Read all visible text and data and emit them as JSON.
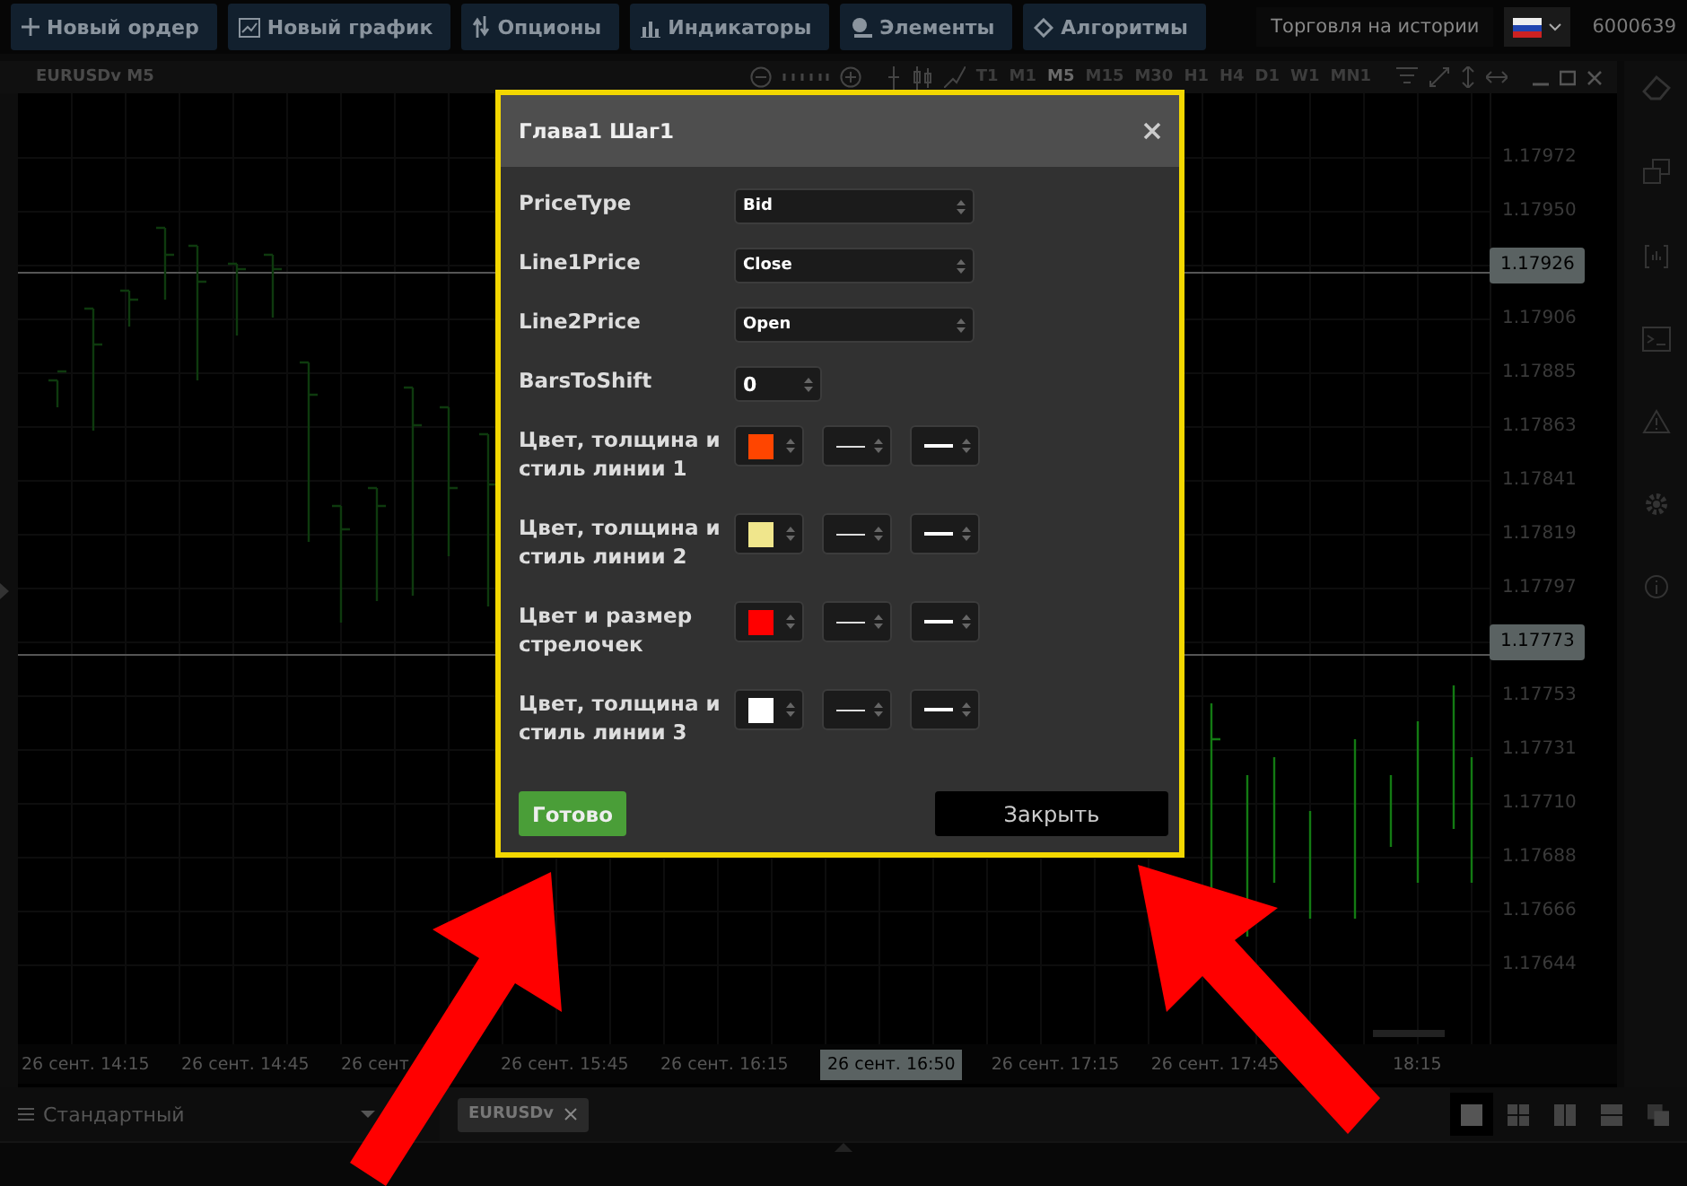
{
  "toolbar": {
    "buttons": [
      {
        "kind": "plus",
        "label": "Новый ордер"
      },
      {
        "kind": "chart",
        "label": "Новый график"
      },
      {
        "kind": "options",
        "label": "Опционы"
      },
      {
        "kind": "bars",
        "label": "Индикаторы"
      },
      {
        "kind": "pin",
        "label": "Элементы"
      },
      {
        "kind": "diamond",
        "label": "Алгоритмы"
      }
    ],
    "history_button": "Торговля на истории",
    "account": "6000639"
  },
  "chart_window": {
    "title": "EURUSDv M5",
    "timeframes": [
      {
        "label": "T1",
        "selected": false
      },
      {
        "label": "M1",
        "selected": false
      },
      {
        "label": "M5",
        "selected": true
      },
      {
        "label": "M15",
        "selected": false
      },
      {
        "label": "M30",
        "selected": false
      },
      {
        "label": "H1",
        "selected": false
      },
      {
        "label": "H4",
        "selected": false
      },
      {
        "label": "D1",
        "selected": false
      },
      {
        "label": "W1",
        "selected": false
      },
      {
        "label": "MN1",
        "selected": false
      }
    ]
  },
  "price_axis": [
    {
      "label": "1.17972",
      "highlighted": false
    },
    {
      "label": "1.17950",
      "highlighted": false
    },
    {
      "label": "1.17926",
      "highlighted": true
    },
    {
      "label": "1.17906",
      "highlighted": false
    },
    {
      "label": "1.17885",
      "highlighted": false
    },
    {
      "label": "1.17863",
      "highlighted": false
    },
    {
      "label": "1.17841",
      "highlighted": false
    },
    {
      "label": "1.17819",
      "highlighted": false
    },
    {
      "label": "1.17797",
      "highlighted": false
    },
    {
      "label": "1.17773",
      "highlighted": true
    },
    {
      "label": "1.17753",
      "highlighted": false
    },
    {
      "label": "1.17731",
      "highlighted": false
    },
    {
      "label": "1.17710",
      "highlighted": false
    },
    {
      "label": "1.17688",
      "highlighted": false
    },
    {
      "label": "1.17666",
      "highlighted": false
    },
    {
      "label": "1.17644",
      "highlighted": false
    }
  ],
  "time_axis": [
    {
      "label": "26 сент. 14:15",
      "highlighted": false
    },
    {
      "label": "26 сент. 14:45",
      "highlighted": false
    },
    {
      "label": "26 сент",
      "highlighted": false
    },
    {
      "label": "26 сент. 15:45",
      "highlighted": false
    },
    {
      "label": "26 сент. 16:15",
      "highlighted": false
    },
    {
      "label": "26 сент. 16:50",
      "highlighted": true
    },
    {
      "label": "26 сент. 17:15",
      "highlighted": false
    },
    {
      "label": "26 сент. 17:45",
      "highlighted": false
    },
    {
      "label": "18:15",
      "highlighted": false
    }
  ],
  "bottom_panel": {
    "profile": "Стандартный",
    "tabs": [
      {
        "label": "EURUSDv",
        "selected": true
      }
    ],
    "layouts": [
      {
        "kind": "single",
        "selected": true
      },
      {
        "kind": "grid",
        "selected": false
      },
      {
        "kind": "columns",
        "selected": false
      },
      {
        "kind": "rows",
        "selected": false
      },
      {
        "kind": "cascade",
        "selected": false
      }
    ]
  },
  "dialog": {
    "title": "Глава1 Шаг1",
    "fields": [
      {
        "kind": "select",
        "label": "PriceType",
        "value": "Bid"
      },
      {
        "kind": "select",
        "label": "Line1Price",
        "value": "Close"
      },
      {
        "kind": "select",
        "label": "Line2Price",
        "value": "Open"
      },
      {
        "kind": "number",
        "label": "BarsToShift",
        "value": "0"
      },
      {
        "kind": "style",
        "label": "Цвет, толщина и стиль линии 1",
        "color": "#ff4500"
      },
      {
        "kind": "style",
        "label": "Цвет, толщина и стиль линии 2",
        "color": "#f0e68c"
      },
      {
        "kind": "style",
        "label": "Цвет и размер стрелочек",
        "color": "#ff0000"
      },
      {
        "kind": "style",
        "label": "Цвет, толщина и стиль линии 3",
        "color": "#ffffff"
      }
    ],
    "ok_button": "Готово",
    "close_button": "Закрыть"
  }
}
